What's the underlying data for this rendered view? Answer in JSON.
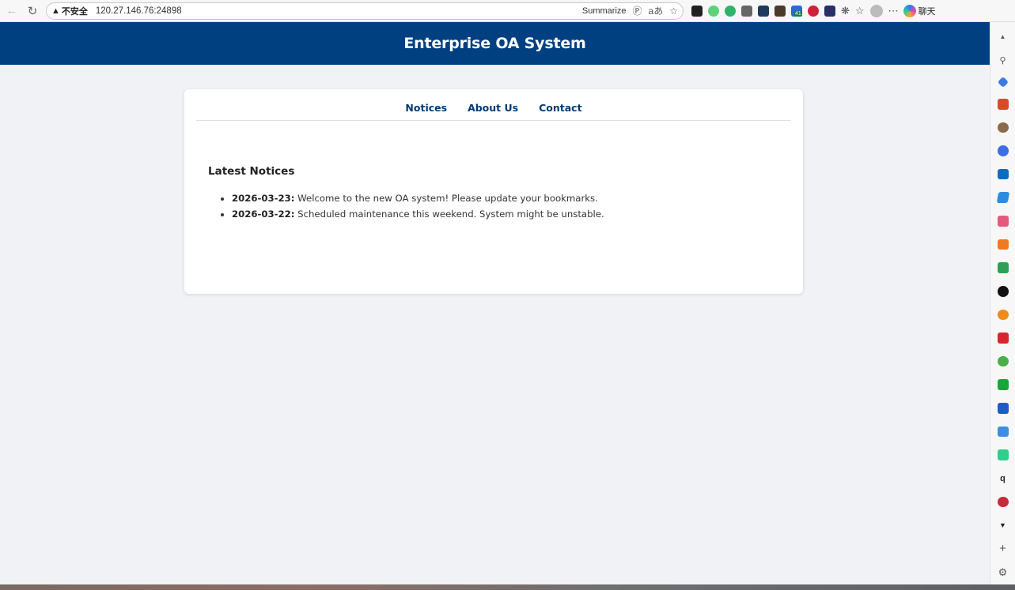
{
  "browser": {
    "security_label": "不安全",
    "url": "120.27.146.76:24898",
    "summarize_label": "Summarize",
    "read_aloud_label": "aあ",
    "chat_label": "聊天",
    "extension_badge": "41"
  },
  "header": {
    "title": "Enterprise OA System"
  },
  "nav": {
    "items": [
      "Notices",
      "About Us",
      "Contact"
    ]
  },
  "notices": {
    "heading": "Latest Notices",
    "items": [
      {
        "date": "2026-03-23:",
        "text": " Welcome to the new OA system! Please update your bookmarks."
      },
      {
        "date": "2026-03-22:",
        "text": " Scheduled maintenance this weekend. System might be unstable."
      }
    ]
  },
  "colors": {
    "header_bg": "#004080",
    "link": "#003a73",
    "page_bg": "#f0f2f5"
  }
}
